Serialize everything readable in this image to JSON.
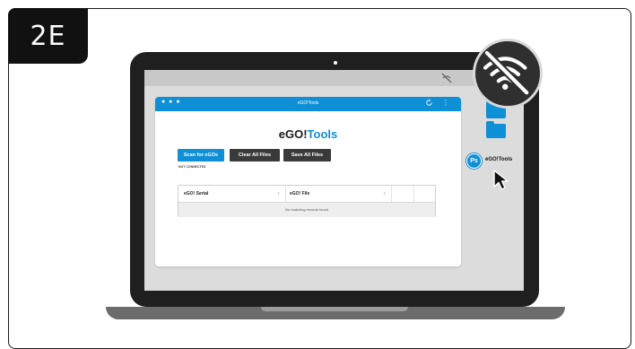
{
  "step": {
    "label": "2E"
  },
  "app": {
    "window_title": "eGO!Tools",
    "brand_prefix": "eGO!",
    "brand_suffix": "Tools",
    "buttons": {
      "scan": "Scan for eGOs",
      "clear": "Clear All Files",
      "save": "Save All Files"
    },
    "status": "NOT CONNECTED",
    "table": {
      "columns": [
        "eGO! Serial",
        "eGO! File"
      ],
      "empty_message": "No matching records found"
    }
  },
  "desktop": {
    "app_icon_glyph": "Ps",
    "app_label": "eGO!Tools"
  },
  "colors": {
    "accent": "#0f8fd6",
    "dark_button": "#3a3a3a",
    "laptop_bezel": "#1f1f1f"
  },
  "icons": [
    "no-wifi-icon",
    "cursor-icon",
    "folder-icon",
    "sync-icon",
    "kebab-menu-icon"
  ]
}
